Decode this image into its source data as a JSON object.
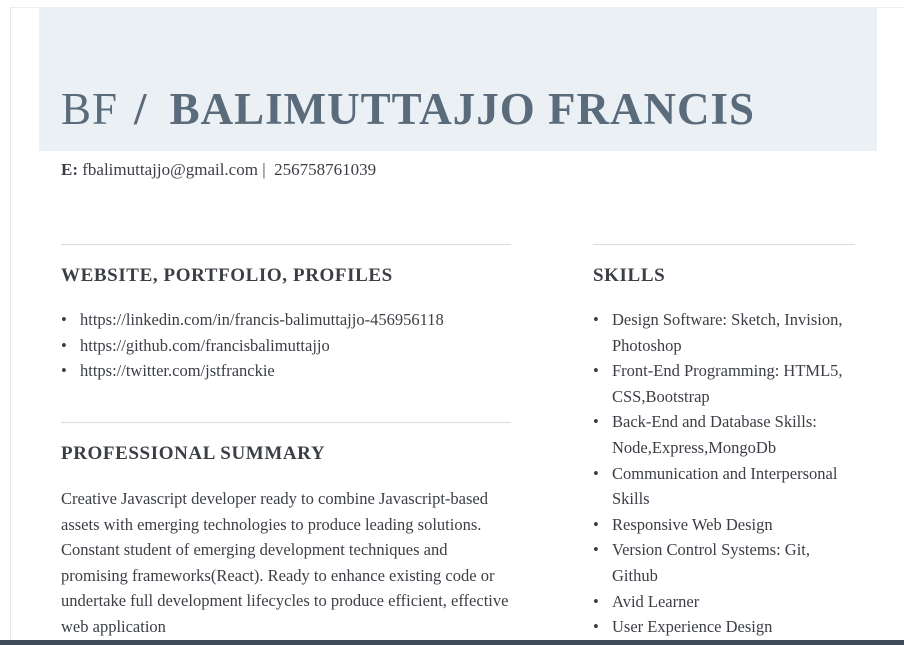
{
  "header": {
    "initials": "BF",
    "separator": "/",
    "full_name": "BALIMUTTAJJO FRANCIS"
  },
  "contact": {
    "email_label": "E:",
    "email": "fbalimuttajjo@gmail.com",
    "divider": "|",
    "phone": "256758761039"
  },
  "sections": {
    "profiles": {
      "title": "WEBSITE, PORTFOLIO, PROFILES",
      "items": [
        "https://linkedin.com/in/francis-balimuttajjo-456956118",
        "https://github.com/francisbalimuttajjo",
        "https://twitter.com/jstfranckie"
      ]
    },
    "summary": {
      "title": "PROFESSIONAL SUMMARY",
      "text": "Creative Javascript developer ready to combine Javascript-based assets with emerging technologies to produce leading solutions. Constant student of emerging development techniques and promising frameworks(React). Ready to enhance existing code or undertake full development lifecycles to produce efficient, effective web application"
    },
    "skills": {
      "title": "SKILLS",
      "items": [
        "Design Software: Sketch, Invision, Photoshop",
        "Front-End Programming: HTML5, CSS,Bootstrap",
        "Back-End and Database Skills: Node,Express,MongoDb",
        "Communication and Interpersonal Skills",
        "Responsive Web Design",
        "Version Control Systems: Git, Github",
        "Avid Learner",
        "User Experience Design"
      ]
    }
  }
}
